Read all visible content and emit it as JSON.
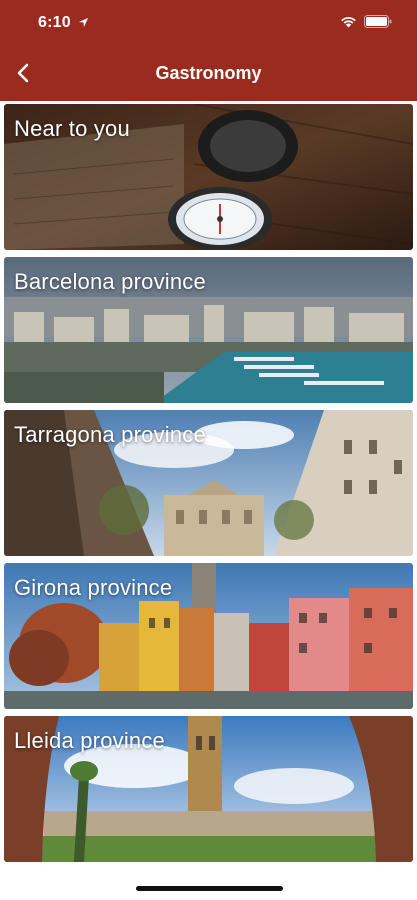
{
  "status_bar": {
    "time": "6:10"
  },
  "nav": {
    "title": "Gastronomy",
    "back_icon": "chevron-left-icon"
  },
  "colors": {
    "header": "#9b2a1f",
    "label_text": "#ffffff"
  },
  "cards": [
    {
      "label": "Near to you"
    },
    {
      "label": "Barcelona province"
    },
    {
      "label": "Tarragona province"
    },
    {
      "label": "Girona province"
    },
    {
      "label": "Lleida province"
    }
  ]
}
